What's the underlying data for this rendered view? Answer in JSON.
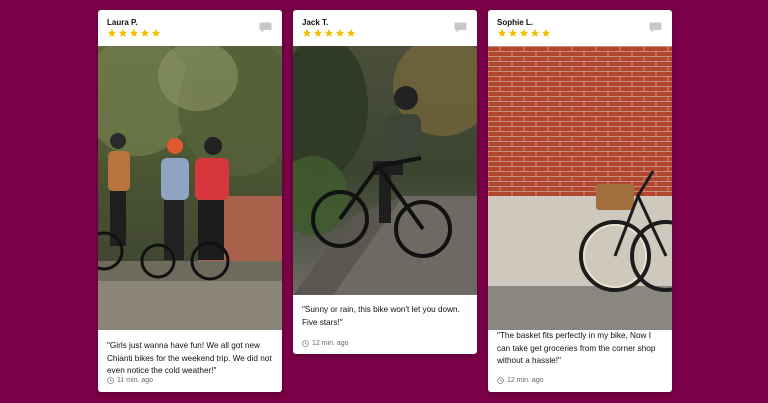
{
  "colors": {
    "background": "#7b0047",
    "star": "#f2c200",
    "card": "#ffffff"
  },
  "reviews": [
    {
      "author": "Laura P.",
      "rating": 5,
      "text": "\"Girls just wanna have fun! We all got new Chianti bikes for the weekend trip. We did not even notice the cold weather!\"",
      "time": "11 min. ago",
      "icon": "comment-icon"
    },
    {
      "author": "Jack T.",
      "rating": 5,
      "text": "\"Sunny or rain, this bike won't let you down. Five stars!\"",
      "time": "12 min. ago",
      "icon": "comment-icon"
    },
    {
      "author": "Sophie L.",
      "rating": 5,
      "text": "\"The basket fits perfectly in my bike, Now I can take get groceries from the corner shop without a hassle!\"",
      "time": "12 min. ago",
      "icon": "comment-icon"
    }
  ]
}
